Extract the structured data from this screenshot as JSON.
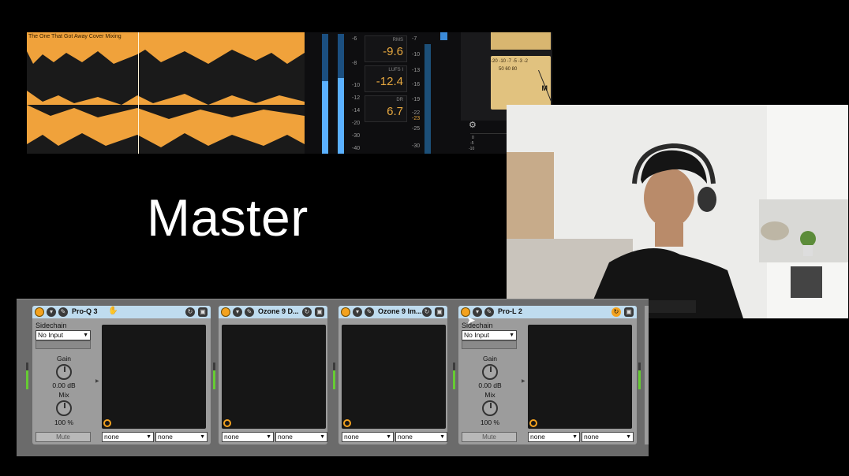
{
  "clip": {
    "title": "The One That Got Away Cover Mixing"
  },
  "meters": {
    "rms_label": "RMS",
    "rms_value": "-9.6",
    "lufs_label": "LUFS I",
    "lufs_value": "-12.4",
    "dr_label": "DR",
    "dr_value": "6.7",
    "left_scale": [
      "-6",
      "-8",
      "-10",
      "-12",
      "-14",
      "-20",
      "-30",
      "-40"
    ],
    "ladder_scale": [
      "-7",
      "-10",
      "-13",
      "-16",
      "-19",
      "-22",
      "-23",
      "-25",
      "-30"
    ],
    "vu_scale": "-20 -10 -7 -5 -3 -2",
    "vu_scale2": "50 60 80",
    "vu_label": "M",
    "graph_ticks": [
      "0",
      "-5",
      "-10"
    ]
  },
  "title": "Master",
  "devices": [
    {
      "name": "Pro-Q 3",
      "has_side": true,
      "sidechain_label": "Sidechain",
      "sidechain_value": "No Input",
      "gain_label": "Gain",
      "gain_value": "0.00 dB",
      "mix_label": "Mix",
      "mix_value": "100 %",
      "mute_label": "Mute",
      "sel1": "none",
      "sel2": "none"
    },
    {
      "name": "Ozone 9 D...",
      "has_side": false,
      "sel1": "none",
      "sel2": "none"
    },
    {
      "name": "Ozone 9 Im...",
      "has_side": false,
      "sel1": "none",
      "sel2": "none"
    },
    {
      "name": "Pro-L 2",
      "has_side": true,
      "sidechain_label": "Sidechain",
      "sidechain_value": "No Input",
      "gain_label": "Gain",
      "gain_value": "0.00 dB",
      "mix_label": "Mix",
      "mix_value": "100 %",
      "mute_label": "Mute",
      "sel1": "none",
      "sel2": "none"
    }
  ],
  "colors": {
    "clip": "#f0a23b",
    "meter_value": "#e7a83f",
    "device_header": "#bfdcef",
    "power_on": "#f3a21f"
  }
}
